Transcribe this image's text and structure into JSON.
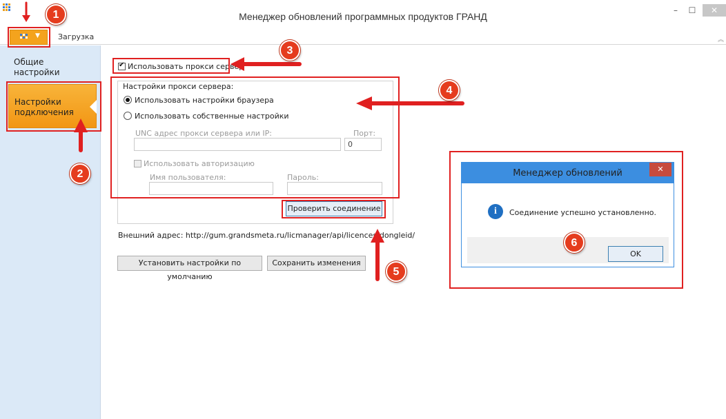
{
  "window": {
    "title": "Менеджер обновлений программных продуктов ГРАНД",
    "min_glyph": "–",
    "max_glyph": "☐",
    "close_glyph": "✕"
  },
  "ribbon": {
    "tab_download": "Загрузка",
    "collapse_glyph": "︽"
  },
  "sidebar": {
    "items": [
      {
        "label": "Общие настройки",
        "line1": "Общие",
        "line2": "настройки"
      },
      {
        "label": "Настройки подключения",
        "line1": "Настройки",
        "line2": "подключения"
      }
    ]
  },
  "proxy": {
    "use_proxy_label": "Использовать прокси сервер",
    "use_proxy_checked": true,
    "group_title": "Настройки прокси сервера:",
    "radio_browser": "Использовать настройки браузера",
    "radio_browser_checked": true,
    "radio_custom": "Использовать собственные настройки",
    "unc_label": "UNC адрес прокси сервера или IP:",
    "unc_value": "",
    "port_label": "Порт:",
    "port_value": "0",
    "use_auth_label": "Использовать авторизацию",
    "username_label": "Имя пользователя:",
    "username_value": "",
    "password_label": "Пароль:",
    "password_value": "",
    "check_button": "Проверить соединение"
  },
  "external_address": "Внешний адрес: http://gum.grandsmeta.ru/licmanager/api/licences/dongleid/",
  "buttons": {
    "defaults": "Установить настройки по умолчанию",
    "save": "Сохранить изменения"
  },
  "dialog": {
    "title": "Менеджер обновлений",
    "close_glyph": "✕",
    "message": "Соединение успешно установленно.",
    "info_glyph": "i",
    "ok": "OK"
  },
  "annotations": {
    "badges": [
      "1",
      "2",
      "3",
      "4",
      "5",
      "6"
    ],
    "color": "#e02020"
  },
  "colors": {
    "accent_orange": "#f29614",
    "sidebar_bg": "#dbe9f7",
    "dialog_blue": "#3c8ee0"
  }
}
